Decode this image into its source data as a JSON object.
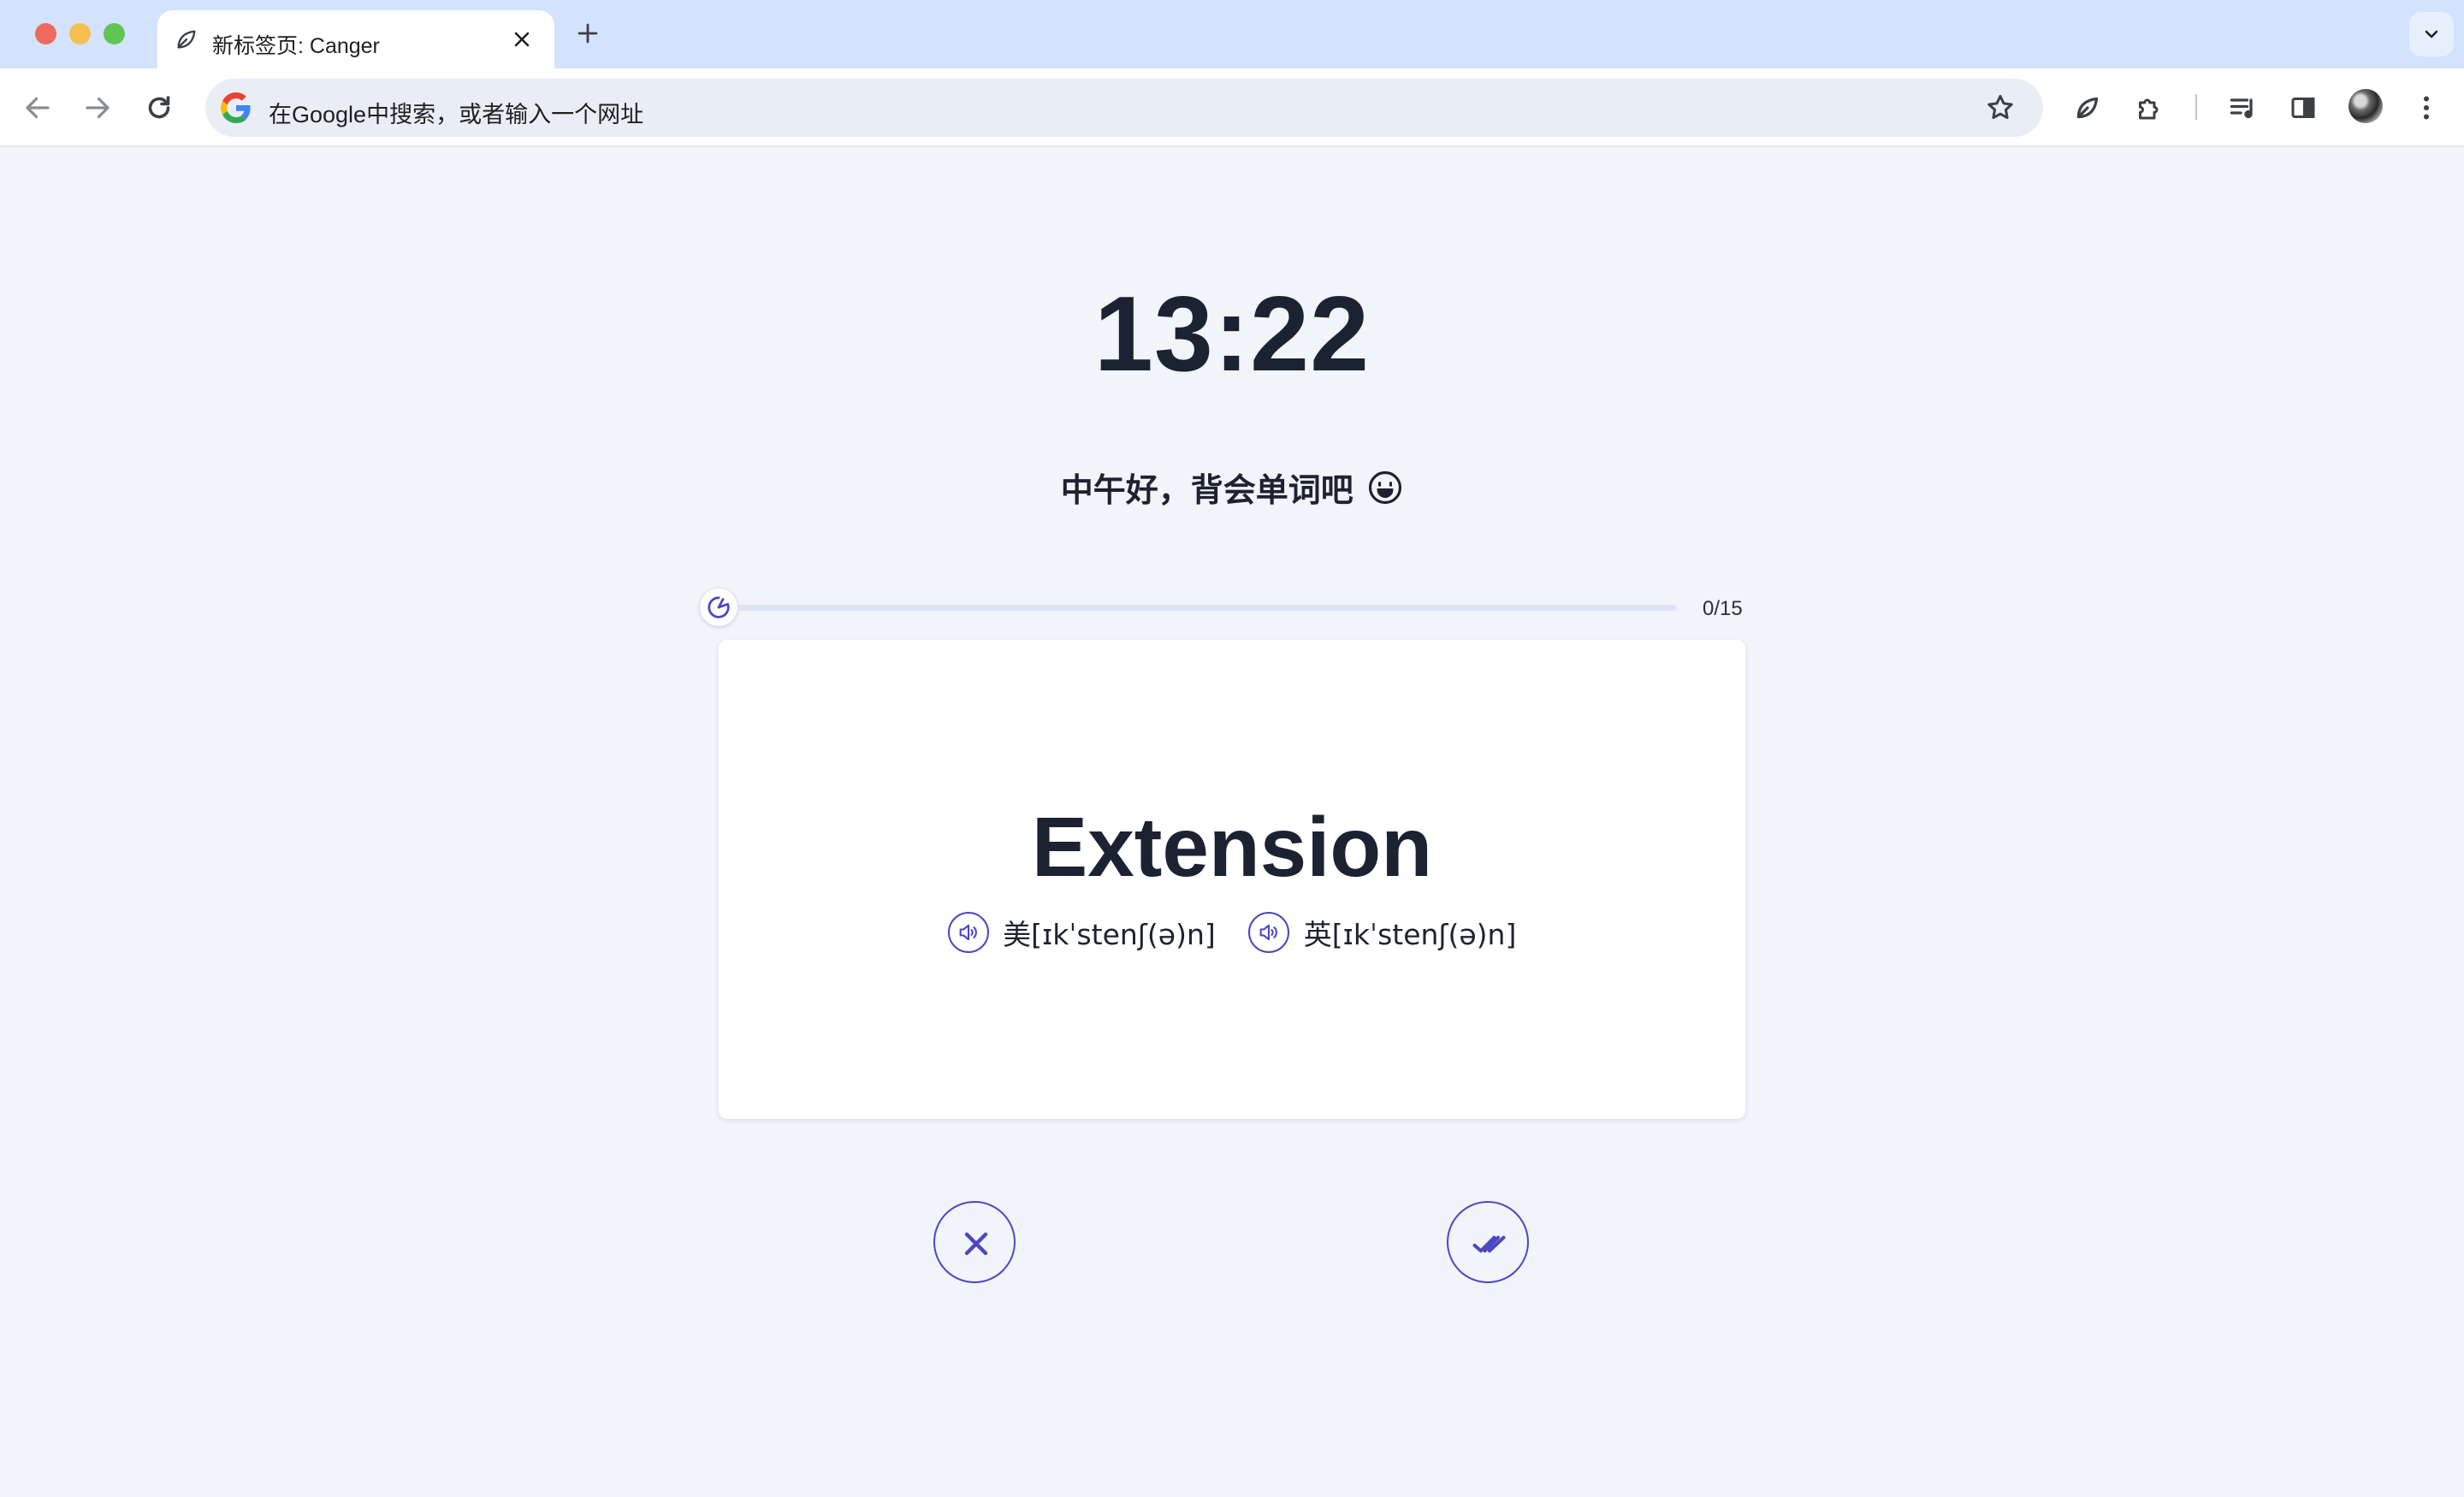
{
  "browser": {
    "tab": {
      "title": "新标签页: Canger",
      "favicon": "leaf-icon"
    },
    "omnibox": {
      "placeholder": "在Google中搜索，或者输入一个网址"
    },
    "icons": [
      "back-icon",
      "forward-icon",
      "reload-icon",
      "google-icon",
      "star-icon",
      "leaf-extension-icon",
      "puzzle-icon",
      "media-icon",
      "side-panel-icon",
      "kebab-menu-icon",
      "new-tab-icon",
      "tab-search-icon"
    ]
  },
  "page": {
    "clock": "13:22",
    "greeting": "中午好，背会单词吧",
    "greeting_icon": "smile-icon",
    "progress": {
      "count_label": "0/15",
      "done": 0,
      "total": 15
    },
    "card": {
      "word": "Extension",
      "phonetics": [
        {
          "label": "美[ɪkˈstenʃ(ə)n]",
          "icon": "speaker-icon"
        },
        {
          "label": "英[ɪkˈstenʃ(ə)n]",
          "icon": "speaker-icon"
        }
      ]
    },
    "actions": {
      "forget_icon": "x-icon",
      "know_icon": "double-check-icon"
    }
  },
  "colors": {
    "accent": "#4b47c3",
    "background": "#f1f4f9",
    "tabstrip": "#d3e3fd",
    "text": "#1b2232"
  }
}
